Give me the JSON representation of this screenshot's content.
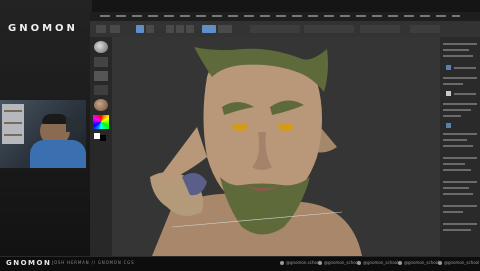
{
  "brand": {
    "logo": "GNOMON",
    "footer_logo": "GNOMON",
    "footer_credit": "JOSH HERMAN // GNOMON CGS"
  },
  "footer": {
    "socials": [
      {
        "handle": "@gnomon.school",
        "icon": "facebook-icon"
      },
      {
        "handle": "@gnomon_school",
        "icon": "twitter-icon"
      },
      {
        "handle": "@gnomon_school",
        "icon": "instagram-icon"
      },
      {
        "handle": "@gnomon_school",
        "icon": "youtube-icon"
      },
      {
        "handle": "@gnomon_school",
        "icon": "vimeo-icon"
      }
    ]
  },
  "colors": {
    "accent": "#5e8fc7",
    "skin": "#b89878",
    "moss": "#5f6a3a",
    "eye": "#d49a1e"
  }
}
